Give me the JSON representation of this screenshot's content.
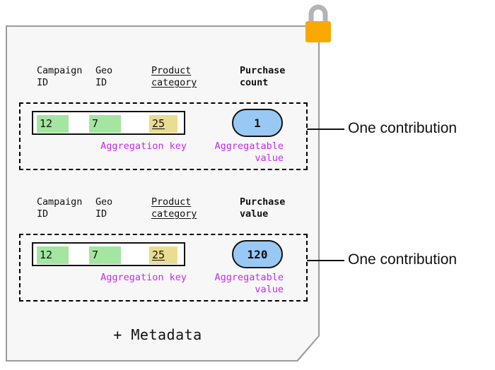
{
  "document": {
    "background_color": "#f7f7f7",
    "border_color": "#9b9b9b",
    "metadata_note": "+ Metadata"
  },
  "padlock": {
    "icon": "padlock-icon",
    "body_color": "#f9a800",
    "shackle_color": "#b4b4b4"
  },
  "palette": {
    "key_green": "#a4e5a1",
    "key_yellow": "#e9dd92",
    "value_blue": "#9ac8f5",
    "caption_magenta": "#c42bee",
    "outline_black": "#111111"
  },
  "contributions": [
    {
      "name": "purchase-count-contribution",
      "headers": {
        "campaign": "Campaign\nID",
        "geo": "Geo\nID",
        "product": "Product\ncategory",
        "metric": "Purchase\ncount"
      },
      "aggregation_key": {
        "cells": [
          {
            "label": "12",
            "color": "#a4e5a1",
            "underlined": false
          },
          {
            "label": "7",
            "color": "#a4e5a1",
            "underlined": false
          },
          {
            "label": "25",
            "color": "#e9dd92",
            "underlined": true
          }
        ],
        "caption": "Aggregation key"
      },
      "aggregatable_value": {
        "value": "1",
        "caption": "Aggregatable\nvalue"
      },
      "callout": "One contribution"
    },
    {
      "name": "purchase-value-contribution",
      "headers": {
        "campaign": "Campaign\nID",
        "geo": "Geo\nID",
        "product": "Product\ncategory",
        "metric": "Purchase\nvalue"
      },
      "aggregation_key": {
        "cells": [
          {
            "label": "12",
            "color": "#a4e5a1",
            "underlined": false
          },
          {
            "label": "7",
            "color": "#a4e5a1",
            "underlined": false
          },
          {
            "label": "25",
            "color": "#e9dd92",
            "underlined": true
          }
        ],
        "caption": "Aggregation key"
      },
      "aggregatable_value": {
        "value": "120",
        "caption": "Aggregatable\nvalue"
      },
      "callout": "One contribution"
    }
  ]
}
